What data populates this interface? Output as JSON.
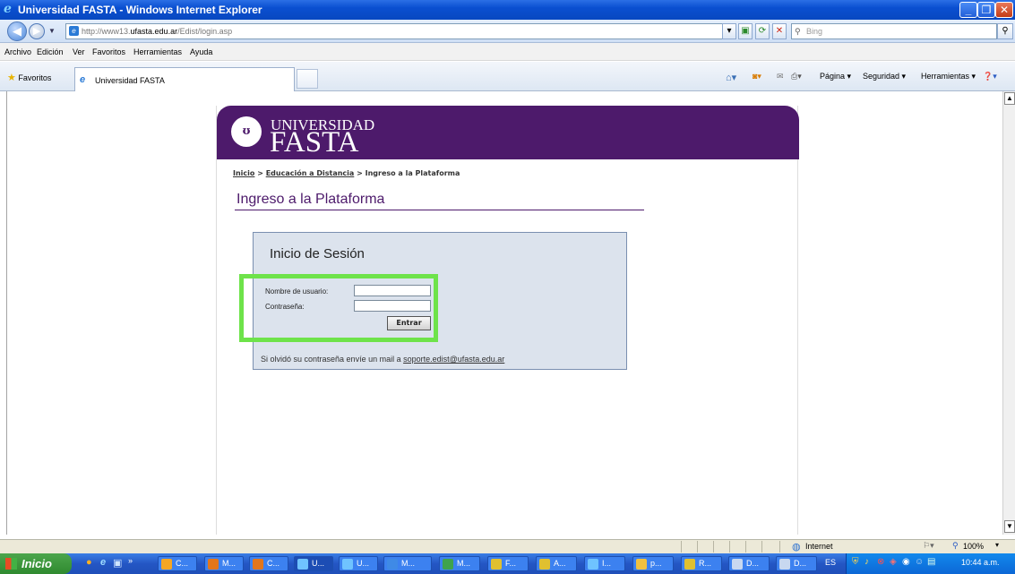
{
  "window": {
    "title": "Universidad FASTA - Windows Internet Explorer"
  },
  "address": {
    "url_prefix": "http://www13.",
    "url_host": "ufasta.edu.ar",
    "url_path": "/Edist/login.asp",
    "search_placeholder": "Bing"
  },
  "menu": [
    "Archivo",
    "Edición",
    "Ver",
    "Favoritos",
    "Herramientas",
    "Ayuda"
  ],
  "favbar": {
    "favorites_label": "Favoritos",
    "tab_label": "Universidad FASTA",
    "commands": [
      "Página ▾",
      "Seguridad ▾",
      "Herramientas ▾"
    ]
  },
  "site": {
    "logo_top": "UNIVERSIDAD",
    "logo_bottom": "FASTA",
    "breadcrumb": {
      "home": "Inicio",
      "sep1": " > ",
      "section": "Educación a Distancia",
      "sep2": " > ",
      "current": "Ingreso a la Plataforma"
    },
    "page_title": "Ingreso a la Plataforma",
    "login": {
      "heading": "Inicio de Sesión",
      "username_label": "Nombre de usuario:",
      "password_label": "Contraseña:",
      "submit_label": "Entrar",
      "forgot_text": "Si olvidó su contraseña envíe un mail a ",
      "support_email": "soporte.edist@ufasta.edu.ar"
    },
    "colors": {
      "brand": "#4d1a6b",
      "panel": "#dce3ed",
      "highlight": "#6ee34a"
    }
  },
  "statusbar": {
    "zone": "Internet",
    "zoom": "100%"
  },
  "taskbar": {
    "start_label": "Inicio",
    "items": [
      "C...",
      "M...",
      "C...",
      "U...",
      "U...",
      "M...",
      "M...",
      "F...",
      "A...",
      "I...",
      "p...",
      "R...",
      "D...",
      "D..."
    ],
    "lang": "ES",
    "clock": "10:44 a.m."
  }
}
